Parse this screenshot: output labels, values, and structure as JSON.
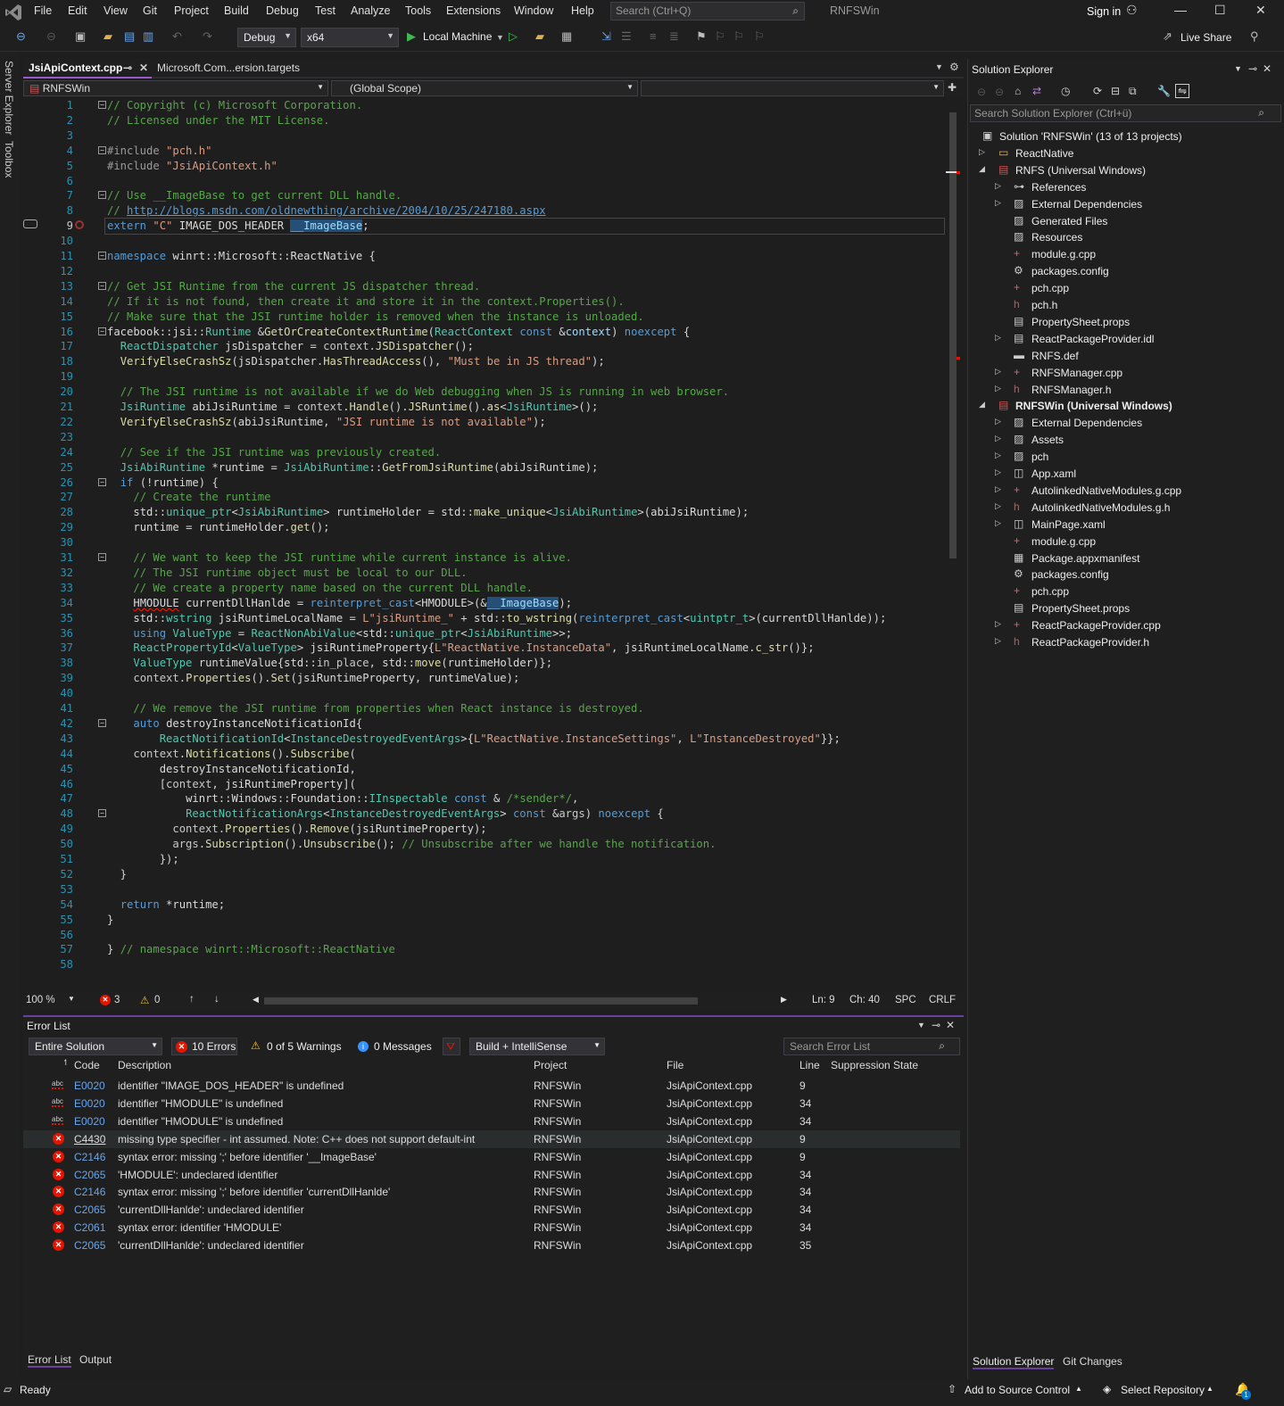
{
  "menu": {
    "items": [
      "File",
      "Edit",
      "View",
      "Git",
      "Project",
      "Build",
      "Debug",
      "Test",
      "Analyze",
      "Tools",
      "Extensions",
      "Window",
      "Help"
    ],
    "search_placeholder": "Search (Ctrl+Q)",
    "app_title": "RNFSWin",
    "sign_in": "Sign in"
  },
  "toolbar": {
    "config": "Debug",
    "platform": "x64",
    "run_target": "Local Machine",
    "live_share": "Live Share"
  },
  "left_rail": {
    "server_explorer": "Server Explorer",
    "toolbox": "Toolbox"
  },
  "doc_tabs": [
    {
      "label": "JsiApiContext.cpp",
      "active": true
    },
    {
      "label": "Microsoft.Com...ersion.targets",
      "active": false
    }
  ],
  "navbar": {
    "project": "RNFSWin",
    "scope": "(Global Scope)",
    "member": ""
  },
  "editor": {
    "current_line": 9,
    "lines": [
      {
        "n": 1,
        "fold": "⊟",
        "html": "<span class='c-cm'>// Copyright (c) Microsoft Corporation.</span>"
      },
      {
        "n": 2,
        "html": "<span class='c-cm'>// Licensed under the MIT License.</span>"
      },
      {
        "n": 3,
        "html": ""
      },
      {
        "n": 4,
        "fold": "⊟",
        "html": "<span class='c-pp'>#include </span><span class='c-str'>\"pch.h\"</span>"
      },
      {
        "n": 5,
        "html": "<span class='c-pp'>#include </span><span class='c-str'>\"JsiApiContext.h\"</span>"
      },
      {
        "n": 6,
        "html": ""
      },
      {
        "n": 7,
        "fold": "⊟",
        "html": "<span class='c-cm'>// Use __ImageBase to get current DLL handle.</span>"
      },
      {
        "n": 8,
        "html": "<span class='c-cm'>// </span><span class='c-url'>http://blogs.msdn.com/oldnewthing/archive/2004/10/25/247180.aspx</span>"
      },
      {
        "n": 9,
        "html": "<span class='c-kw'>extern</span> <span class='c-str'>\"C\"</span> <span class='c-wht'>IMAGE_DOS_HEADER</span> <span class='hl c-var'>__ImageBase</span>;"
      },
      {
        "n": 10,
        "html": ""
      },
      {
        "n": 11,
        "fold": "⊟",
        "html": "<span class='c-kw'>namespace</span> <span class='c-wht'>winrt</span>::<span class='c-wht'>Microsoft</span>::<span class='c-wht'>ReactNative</span> {"
      },
      {
        "n": 12,
        "html": ""
      },
      {
        "n": 13,
        "fold": "⊟",
        "html": "<span class='c-cm'>// Get JSI Runtime from the current JS dispatcher thread.</span>"
      },
      {
        "n": 14,
        "html": "<span class='c-cm'>// If it is not found, then create it and store it in the context.Properties().</span>"
      },
      {
        "n": 15,
        "html": "<span class='c-cm'>// Make sure that the JSI runtime holder is removed when the instance is unloaded.</span>"
      },
      {
        "n": 16,
        "fold": "⊟",
        "html": "<span class='c-wht'>facebook</span>::<span class='c-wht'>jsi</span>::<span class='c-ty'>Runtime</span> &amp;<span class='c-fn'>GetOrCreateContextRuntime</span>(<span class='c-ty'>ReactContext</span> <span class='c-kw'>const</span> &amp;<span class='c-var'>context</span>) <span class='c-kw'>noexcept</span> {"
      },
      {
        "n": 17,
        "html": "  <span class='c-ty'>ReactDispatcher</span> <span class='c-wht'>jsDispatcher</span> = <span class='c-id'>context</span>.<span class='c-fn'>JSDispatcher</span>();"
      },
      {
        "n": 18,
        "html": "  <span class='c-fn'>VerifyElseCrashSz</span>(<span class='c-wht'>jsDispatcher</span>.<span class='c-fn'>HasThreadAccess</span>(), <span class='c-str'>\"Must be in JS thread\"</span>);"
      },
      {
        "n": 19,
        "html": ""
      },
      {
        "n": 20,
        "html": "  <span class='c-cm'>// The JSI runtime is not available if we do Web debugging when JS is running in web browser.</span>"
      },
      {
        "n": 21,
        "html": "  <span class='c-ty'>JsiRuntime</span> <span class='c-wht'>abiJsiRuntime</span> = <span class='c-id'>context</span>.<span class='c-fn'>Handle</span>().<span class='c-fn'>JSRuntime</span>().<span class='c-fn'>as</span>&lt;<span class='c-ty'>JsiRuntime</span>&gt;();"
      },
      {
        "n": 22,
        "html": "  <span class='c-fn'>VerifyElseCrashSz</span>(<span class='c-wht'>abiJsiRuntime</span>, <span class='c-str'>\"JSI runtime is not available\"</span>);"
      },
      {
        "n": 23,
        "html": ""
      },
      {
        "n": 24,
        "html": "  <span class='c-cm'>// See if the JSI runtime was previously created.</span>"
      },
      {
        "n": 25,
        "html": "  <span class='c-ty'>JsiAbiRuntime</span> *<span class='c-wht'>runtime</span> = <span class='c-ty'>JsiAbiRuntime</span>::<span class='c-fn'>GetFromJsiRuntime</span>(<span class='c-wht'>abiJsiRuntime</span>);"
      },
      {
        "n": 26,
        "fold": "⊟",
        "html": "  <span class='c-kw'>if</span> (!<span class='c-wht'>runtime</span>) {"
      },
      {
        "n": 27,
        "html": "    <span class='c-cm'>// Create the runtime</span>"
      },
      {
        "n": 28,
        "html": "    <span class='c-wht'>std</span>::<span class='c-ty'>unique_ptr</span>&lt;<span class='c-ty'>JsiAbiRuntime</span>&gt; <span class='c-wht'>runtimeHolder</span> = <span class='c-wht'>std</span>::<span class='c-fn'>make_unique</span>&lt;<span class='c-ty'>JsiAbiRuntime</span>&gt;(<span class='c-wht'>abiJsiRuntime</span>);"
      },
      {
        "n": 29,
        "html": "    <span class='c-wht'>runtime</span> = <span class='c-wht'>runtimeHolder</span>.<span class='c-fn'>get</span>();"
      },
      {
        "n": 30,
        "html": ""
      },
      {
        "n": 31,
        "fold": "⊟",
        "html": "    <span class='c-cm'>// We want to keep the JSI runtime while current instance is alive.</span>"
      },
      {
        "n": 32,
        "html": "    <span class='c-cm'>// The JSI runtime object must be local to our DLL.</span>"
      },
      {
        "n": 33,
        "html": "    <span class='c-cm'>// We create a property name based on the current DLL handle.</span>"
      },
      {
        "n": 34,
        "html": "    <span class='c-wht squig'>HMODULE</span> <span class='c-wht'>currentDllHanlde</span> = <span class='c-kw'>reinterpret_cast</span>&lt;<span class='c-wht'>HMODULE</span>&gt;(&amp;<span class='hl c-var'>__ImageBase</span>);"
      },
      {
        "n": 35,
        "html": "    <span class='c-wht'>std</span>::<span class='c-ty'>wstring</span> <span class='c-wht'>jsiRuntimeLocalName</span> = <span class='c-str'>L\"jsiRuntime_\"</span> + <span class='c-wht'>std</span>::<span class='c-fn'>to_wstring</span>(<span class='c-kw'>reinterpret_cast</span>&lt;<span class='c-ty'>uintptr_t</span>&gt;(<span class='c-wht'>currentDllHanlde</span>));"
      },
      {
        "n": 36,
        "html": "    <span class='c-kw'>using</span> <span class='c-ty'>ValueType</span> = <span class='c-ty'>ReactNonAbiValue</span>&lt;<span class='c-wht'>std</span>::<span class='c-ty'>unique_ptr</span>&lt;<span class='c-ty'>JsiAbiRuntime</span>&gt;&gt;;"
      },
      {
        "n": 37,
        "html": "    <span class='c-ty'>ReactPropertyId</span>&lt;<span class='c-ty'>ValueType</span>&gt; <span class='c-wht'>jsiRuntimeProperty</span>{<span class='c-str'>L\"ReactNative.InstanceData\"</span>, <span class='c-wht'>jsiRuntimeLocalName</span>.<span class='c-fn'>c_str</span>()};"
      },
      {
        "n": 38,
        "html": "    <span class='c-ty'>ValueType</span> <span class='c-wht'>runtimeValue</span>{<span class='c-wht'>std</span>::<span class='c-id'>in_place</span>, <span class='c-wht'>std</span>::<span class='c-fn'>move</span>(<span class='c-wht'>runtimeHolder</span>)};"
      },
      {
        "n": 39,
        "html": "    <span class='c-id'>context</span>.<span class='c-fn'>Properties</span>().<span class='c-fn'>Set</span>(<span class='c-wht'>jsiRuntimeProperty</span>, <span class='c-wht'>runtimeValue</span>);"
      },
      {
        "n": 40,
        "html": ""
      },
      {
        "n": 41,
        "html": "    <span class='c-cm'>// We remove the JSI runtime from properties when React instance is destroyed.</span>"
      },
      {
        "n": 42,
        "fold": "⊟",
        "html": "    <span class='c-kw'>auto</span> <span class='c-wht'>destroyInstanceNotificationId</span>{"
      },
      {
        "n": 43,
        "html": "        <span class='c-ty'>ReactNotificationId</span>&lt;<span class='c-ty'>InstanceDestroyedEventArgs</span>&gt;{<span class='c-str'>L\"ReactNative.InstanceSettings\"</span>, <span class='c-str'>L\"InstanceDestroyed\"</span>}};"
      },
      {
        "n": 44,
        "html": "    <span class='c-id'>context</span>.<span class='c-fn'>Notifications</span>().<span class='c-fn'>Subscribe</span>("
      },
      {
        "n": 45,
        "html": "        <span class='c-wht'>destroyInstanceNotificationId</span>,"
      },
      {
        "n": 46,
        "html": "        [<span class='c-id'>context</span>, <span class='c-wht'>jsiRuntimeProperty</span>]("
      },
      {
        "n": 47,
        "html": "            <span class='c-wht'>winrt</span>::<span class='c-wht'>Windows</span>::<span class='c-wht'>Foundation</span>::<span class='c-ty'>IInspectable</span> <span class='c-kw'>const</span> &amp; <span class='c-cm'>/*sender*/</span>,"
      },
      {
        "n": 48,
        "fold": "⊟",
        "html": "            <span class='c-ty'>ReactNotificationArgs</span>&lt;<span class='c-ty'>InstanceDestroyedEventArgs</span>&gt; <span class='c-kw'>const</span> &amp;<span class='c-id'>args</span>) <span class='c-kw'>noexcept</span> {"
      },
      {
        "n": 49,
        "html": "          <span class='c-id'>context</span>.<span class='c-fn'>Properties</span>().<span class='c-fn'>Remove</span>(<span class='c-wht'>jsiRuntimeProperty</span>);"
      },
      {
        "n": 50,
        "html": "          <span class='c-id'>args</span>.<span class='c-fn'>Subscription</span>().<span class='c-fn'>Unsubscribe</span>(); <span class='c-cm'>// Unsubscribe after we handle the notification.</span>"
      },
      {
        "n": 51,
        "html": "        });"
      },
      {
        "n": 52,
        "html": "  }"
      },
      {
        "n": 53,
        "html": ""
      },
      {
        "n": 54,
        "html": "  <span class='c-kw'>return</span> *<span class='c-wht'>runtime</span>;"
      },
      {
        "n": 55,
        "html": "}"
      },
      {
        "n": 56,
        "html": ""
      },
      {
        "n": 57,
        "html": "} <span class='c-cm'>// namespace winrt::Microsoft::ReactNative</span>"
      },
      {
        "n": 58,
        "html": ""
      }
    ]
  },
  "editor_status": {
    "zoom": "100 %",
    "errors": "3",
    "warnings": "0",
    "line": "Ln: 9",
    "col": "Ch: 40",
    "whitespace": "SPC",
    "eol": "CRLF"
  },
  "error_list": {
    "title": "Error List",
    "scope": "Entire Solution",
    "errors_btn": "10 Errors",
    "warnings_btn": "0 of 5 Warnings",
    "messages_btn": "0 Messages",
    "build_filter": "Build + IntelliSense",
    "search_placeholder": "Search Error List",
    "columns": [
      "Code",
      "Description",
      "Project",
      "File",
      "Line",
      "Suppression State"
    ],
    "rows": [
      {
        "type": "abc",
        "code": "E0020",
        "desc": "identifier \"IMAGE_DOS_HEADER\" is undefined",
        "project": "RNFSWin",
        "file": "JsiApiContext.cpp",
        "line": "9"
      },
      {
        "type": "abc",
        "code": "E0020",
        "desc": "identifier \"HMODULE\" is undefined",
        "project": "RNFSWin",
        "file": "JsiApiContext.cpp",
        "line": "34"
      },
      {
        "type": "abc",
        "code": "E0020",
        "desc": "identifier \"HMODULE\" is undefined",
        "project": "RNFSWin",
        "file": "JsiApiContext.cpp",
        "line": "34"
      },
      {
        "type": "err",
        "code": "C4430",
        "desc": "missing type specifier - int assumed. Note: C++ does not support default-int",
        "project": "RNFSWin",
        "file": "JsiApiContext.cpp",
        "line": "9",
        "selected": true
      },
      {
        "type": "err",
        "code": "C2146",
        "desc": "syntax error: missing ';' before identifier '__ImageBase'",
        "project": "RNFSWin",
        "file": "JsiApiContext.cpp",
        "line": "9"
      },
      {
        "type": "err",
        "code": "C2065",
        "desc": "'HMODULE': undeclared identifier",
        "project": "RNFSWin",
        "file": "JsiApiContext.cpp",
        "line": "34"
      },
      {
        "type": "err",
        "code": "C2146",
        "desc": "syntax error: missing ';' before identifier 'currentDllHanlde'",
        "project": "RNFSWin",
        "file": "JsiApiContext.cpp",
        "line": "34"
      },
      {
        "type": "err",
        "code": "C2065",
        "desc": "'currentDllHanlde': undeclared identifier",
        "project": "RNFSWin",
        "file": "JsiApiContext.cpp",
        "line": "34"
      },
      {
        "type": "err",
        "code": "C2061",
        "desc": "syntax error: identifier 'HMODULE'",
        "project": "RNFSWin",
        "file": "JsiApiContext.cpp",
        "line": "34"
      },
      {
        "type": "err",
        "code": "C2065",
        "desc": "'currentDllHanlde': undeclared identifier",
        "project": "RNFSWin",
        "file": "JsiApiContext.cpp",
        "line": "35"
      }
    ],
    "bottom_tabs": [
      "Error List",
      "Output"
    ]
  },
  "solution_explorer": {
    "title": "Solution Explorer",
    "search_placeholder": "Search Solution Explorer (Ctrl+ü)",
    "tree": [
      {
        "label": "Solution 'RNFSWin' (13 of 13 projects)",
        "depth": 0,
        "exp": "",
        "icon": "solution-icon"
      },
      {
        "label": "ReactNative",
        "depth": 1,
        "exp": "▷",
        "icon": "folder-icon"
      },
      {
        "label": "RNFS (Universal Windows)",
        "depth": 1,
        "exp": "◢",
        "icon": "project-icon"
      },
      {
        "label": "References",
        "depth": 2,
        "exp": "▷",
        "icon": "references-icon"
      },
      {
        "label": "External Dependencies",
        "depth": 2,
        "exp": "▷",
        "icon": "filter-icon"
      },
      {
        "label": "Generated Files",
        "depth": 2,
        "exp": "",
        "icon": "filter-icon"
      },
      {
        "label": "Resources",
        "depth": 2,
        "exp": "",
        "icon": "filter-icon"
      },
      {
        "label": "module.g.cpp",
        "depth": 2,
        "exp": "",
        "icon": "cpp-icon"
      },
      {
        "label": "packages.config",
        "depth": 2,
        "exp": "",
        "icon": "config-icon"
      },
      {
        "label": "pch.cpp",
        "depth": 2,
        "exp": "",
        "icon": "cpp-icon"
      },
      {
        "label": "pch.h",
        "depth": 2,
        "exp": "",
        "icon": "header-icon"
      },
      {
        "label": "PropertySheet.props",
        "depth": 2,
        "exp": "",
        "icon": "props-icon"
      },
      {
        "label": "ReactPackageProvider.idl",
        "depth": 2,
        "exp": "▷",
        "icon": "idl-icon"
      },
      {
        "label": "RNFS.def",
        "depth": 2,
        "exp": "",
        "icon": "def-icon"
      },
      {
        "label": "RNFSManager.cpp",
        "depth": 2,
        "exp": "▷",
        "icon": "cpp-icon"
      },
      {
        "label": "RNFSManager.h",
        "depth": 2,
        "exp": "▷",
        "icon": "header-icon"
      },
      {
        "label": "RNFSWin (Universal Windows)",
        "depth": 1,
        "exp": "◢",
        "icon": "project-icon",
        "bold": true
      },
      {
        "label": "External Dependencies",
        "depth": 2,
        "exp": "▷",
        "icon": "filter-icon"
      },
      {
        "label": "Assets",
        "depth": 2,
        "exp": "▷",
        "icon": "filter-icon"
      },
      {
        "label": "pch",
        "depth": 2,
        "exp": "▷",
        "icon": "filter-icon"
      },
      {
        "label": "App.xaml",
        "depth": 2,
        "exp": "▷",
        "icon": "xaml-icon"
      },
      {
        "label": "AutolinkedNativeModules.g.cpp",
        "depth": 2,
        "exp": "▷",
        "icon": "cpp-icon"
      },
      {
        "label": "AutolinkedNativeModules.g.h",
        "depth": 2,
        "exp": "▷",
        "icon": "header-icon"
      },
      {
        "label": "MainPage.xaml",
        "depth": 2,
        "exp": "▷",
        "icon": "xaml-icon"
      },
      {
        "label": "module.g.cpp",
        "depth": 2,
        "exp": "",
        "icon": "cpp-icon"
      },
      {
        "label": "Package.appxmanifest",
        "depth": 2,
        "exp": "",
        "icon": "manifest-icon"
      },
      {
        "label": "packages.config",
        "depth": 2,
        "exp": "",
        "icon": "config-icon"
      },
      {
        "label": "pch.cpp",
        "depth": 2,
        "exp": "",
        "icon": "cpp-icon"
      },
      {
        "label": "PropertySheet.props",
        "depth": 2,
        "exp": "",
        "icon": "props-icon"
      },
      {
        "label": "ReactPackageProvider.cpp",
        "depth": 2,
        "exp": "▷",
        "icon": "cpp-icon"
      },
      {
        "label": "ReactPackageProvider.h",
        "depth": 2,
        "exp": "▷",
        "icon": "header-icon"
      }
    ],
    "bottom_tabs": [
      "Solution Explorer",
      "Git Changes"
    ]
  },
  "statusbar": {
    "ready": "Ready",
    "source_control": "Add to Source Control",
    "repo": "Select Repository",
    "notifications": "1"
  },
  "colors": {
    "accent": "#6a3fa0",
    "error": "#e51400",
    "background": "#1e1e1e"
  }
}
